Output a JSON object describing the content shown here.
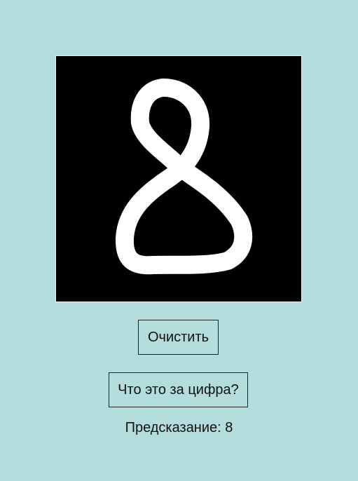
{
  "canvas": {
    "background_color": "#000000",
    "stroke_color": "#ffffff",
    "drawn_content": "handwritten digit"
  },
  "buttons": {
    "clear_label": "Очистить",
    "predict_label": "Что это за цифра?"
  },
  "prediction": {
    "label": "Предсказание:",
    "value": "8"
  },
  "colors": {
    "page_background": "#b3dddd",
    "text": "#111111",
    "button_border": "#222222"
  }
}
